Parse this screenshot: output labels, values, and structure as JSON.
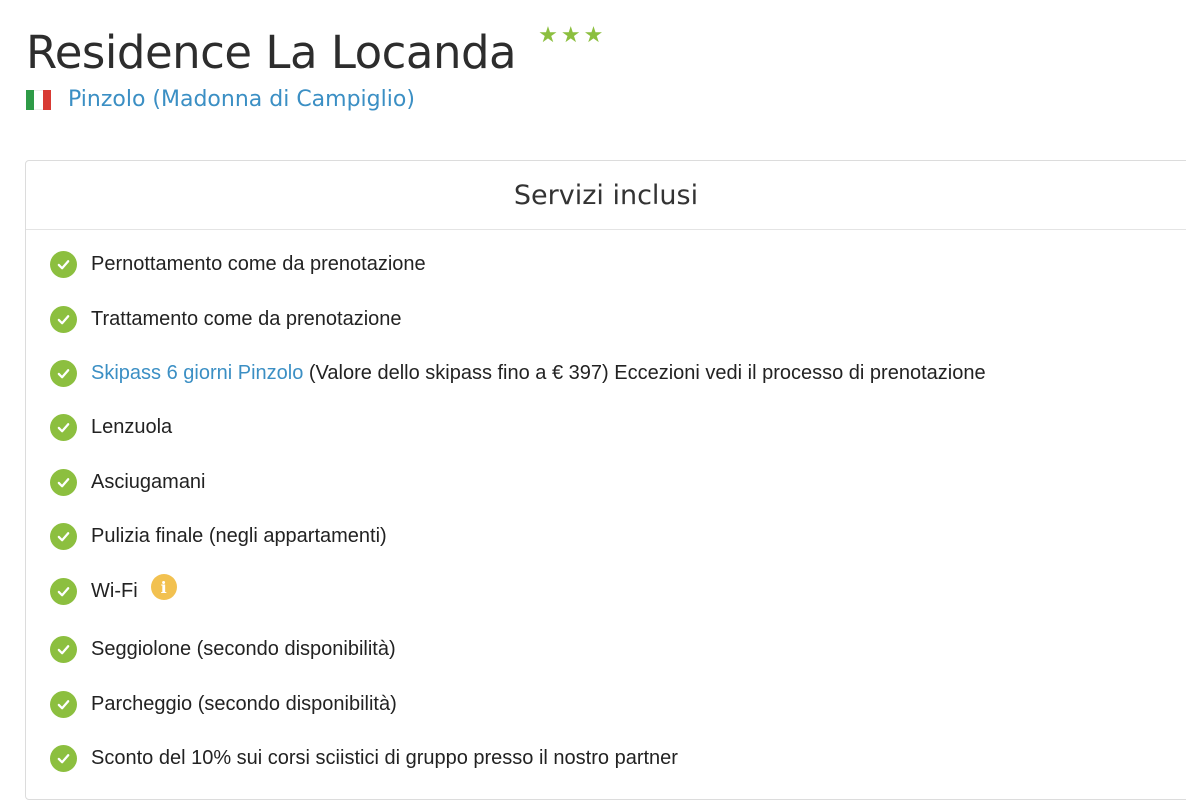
{
  "hotel": {
    "name": "Residence La Locanda",
    "stars": "★★★",
    "location": "Pinzolo (Madonna di Campiglio)",
    "flag_colors": [
      "#2e9b47",
      "#ffffff",
      "#d83a34"
    ]
  },
  "services_section": {
    "title": "Servizi inclusi",
    "items": [
      {
        "text": "Pernottamento come da prenotazione"
      },
      {
        "text": "Trattamento come da prenotazione"
      },
      {
        "link": "Skipass 6 giorni Pinzolo",
        "text": " (Valore dello skipass fino a € 397) Eccezioni vedi il processo di prenotazione"
      },
      {
        "text": "Lenzuola"
      },
      {
        "text": "Asciugamani"
      },
      {
        "text": "Pulizia finale (negli appartamenti)"
      },
      {
        "text": "Wi-Fi",
        "info_icon": "i"
      },
      {
        "text": "Seggiolone (secondo disponibilità)"
      },
      {
        "text": "Parcheggio (secondo disponibilità)"
      },
      {
        "text": "Sconto del 10% sui corsi sciistici di gruppo presso il nostro partner"
      }
    ]
  },
  "colors": {
    "accent_green": "#8cbf3f",
    "link_blue": "#3b8fc4",
    "info_yellow": "#f2c150"
  }
}
